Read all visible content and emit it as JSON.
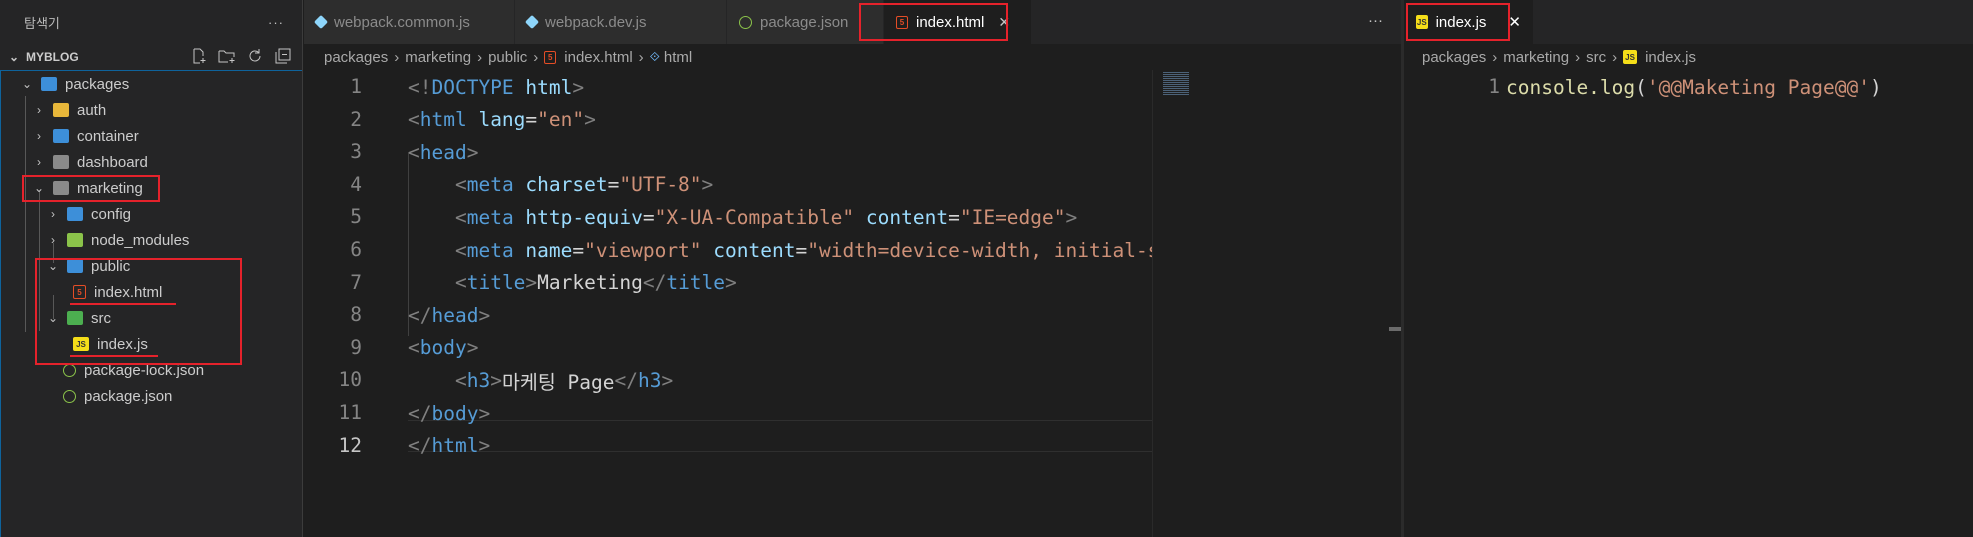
{
  "explorer": {
    "title": "탐색기",
    "more": "···",
    "section": "MYBLOG",
    "tree": [
      {
        "label": "packages",
        "kind": "folder-open"
      },
      {
        "label": "auth",
        "kind": "folder"
      },
      {
        "label": "container",
        "kind": "folder"
      },
      {
        "label": "dashboard",
        "kind": "folder"
      },
      {
        "label": "marketing",
        "kind": "folder-open"
      },
      {
        "label": "config",
        "kind": "folder"
      },
      {
        "label": "node_modules",
        "kind": "folder"
      },
      {
        "label": "public",
        "kind": "folder-open"
      },
      {
        "label": "index.html",
        "kind": "html"
      },
      {
        "label": "src",
        "kind": "folder-open"
      },
      {
        "label": "index.js",
        "kind": "js"
      },
      {
        "label": "package-lock.json",
        "kind": "json"
      },
      {
        "label": "package.json",
        "kind": "json"
      }
    ]
  },
  "left_editor": {
    "tabs": [
      {
        "label": "webpack.common.js",
        "icon": "webpack"
      },
      {
        "label": "webpack.dev.js",
        "icon": "webpack"
      },
      {
        "label": "package.json",
        "icon": "json"
      },
      {
        "label": "index.html",
        "icon": "html",
        "close": "✕"
      }
    ],
    "more": "···",
    "breadcrumb": [
      "packages",
      "marketing",
      "public",
      "index.html",
      "html"
    ],
    "line_numbers": [
      "1",
      "2",
      "3",
      "4",
      "5",
      "6",
      "7",
      "8",
      "9",
      "10",
      "11",
      "12"
    ],
    "lines": [
      [
        [
          "br",
          "<!"
        ],
        [
          "tag",
          "DOCTYPE "
        ],
        [
          "attr",
          "html"
        ],
        [
          "br",
          ">"
        ]
      ],
      [
        [
          "br",
          "<"
        ],
        [
          "tag",
          "html "
        ],
        [
          "attr",
          "lang"
        ],
        [
          "punc",
          "="
        ],
        [
          "str",
          "\"en\""
        ],
        [
          "br",
          ">"
        ]
      ],
      [
        [
          "br",
          "<"
        ],
        [
          "tag",
          "head"
        ],
        [
          "br",
          ">"
        ]
      ],
      [
        [
          "txt",
          "    "
        ],
        [
          "br",
          "<"
        ],
        [
          "tag",
          "meta "
        ],
        [
          "attr",
          "charset"
        ],
        [
          "punc",
          "="
        ],
        [
          "str",
          "\"UTF-8\""
        ],
        [
          "br",
          ">"
        ]
      ],
      [
        [
          "txt",
          "    "
        ],
        [
          "br",
          "<"
        ],
        [
          "tag",
          "meta "
        ],
        [
          "attr",
          "http-equiv"
        ],
        [
          "punc",
          "="
        ],
        [
          "str",
          "\"X-UA-Compatible\" "
        ],
        [
          "attr",
          "content"
        ],
        [
          "punc",
          "="
        ],
        [
          "str",
          "\"IE=edge\""
        ],
        [
          "br",
          ">"
        ]
      ],
      [
        [
          "txt",
          "    "
        ],
        [
          "br",
          "<"
        ],
        [
          "tag",
          "meta "
        ],
        [
          "attr",
          "name"
        ],
        [
          "punc",
          "="
        ],
        [
          "str",
          "\"viewport\" "
        ],
        [
          "attr",
          "content"
        ],
        [
          "punc",
          "="
        ],
        [
          "str",
          "\"width=device-width, initial-scale="
        ]
      ],
      [
        [
          "txt",
          "    "
        ],
        [
          "br",
          "<"
        ],
        [
          "tag",
          "title"
        ],
        [
          "br",
          ">"
        ],
        [
          "txt",
          "Marketing"
        ],
        [
          "br",
          "</"
        ],
        [
          "tag",
          "title"
        ],
        [
          "br",
          ">"
        ]
      ],
      [
        [
          "br",
          "</"
        ],
        [
          "tag",
          "head"
        ],
        [
          "br",
          ">"
        ]
      ],
      [
        [
          "br",
          "<"
        ],
        [
          "tag",
          "body"
        ],
        [
          "br",
          ">"
        ]
      ],
      [
        [
          "txt",
          "    "
        ],
        [
          "br",
          "<"
        ],
        [
          "tag",
          "h3"
        ],
        [
          "br",
          ">"
        ],
        [
          "txt",
          "마케팅 Page"
        ],
        [
          "br",
          "</"
        ],
        [
          "tag",
          "h3"
        ],
        [
          "br",
          ">"
        ]
      ],
      [
        [
          "br",
          "</"
        ],
        [
          "tag",
          "body"
        ],
        [
          "br",
          ">"
        ]
      ],
      [
        [
          "br",
          "</"
        ],
        [
          "tag",
          "html"
        ],
        [
          "br",
          ">"
        ]
      ]
    ]
  },
  "right_editor": {
    "tab": {
      "label": "index.js",
      "close": "✕"
    },
    "breadcrumb": [
      "packages",
      "marketing",
      "src",
      "index.js"
    ],
    "line_numbers": [
      "1"
    ],
    "lines": [
      [
        [
          "fn",
          "console.log"
        ],
        [
          "punc",
          "("
        ],
        [
          "str",
          "'@@Maketing Page@@'"
        ],
        [
          "punc",
          ")"
        ]
      ]
    ]
  },
  "colors": {
    "accent": "#0e639c",
    "highlight": "#e5222b",
    "background": "#1e1e1e"
  }
}
